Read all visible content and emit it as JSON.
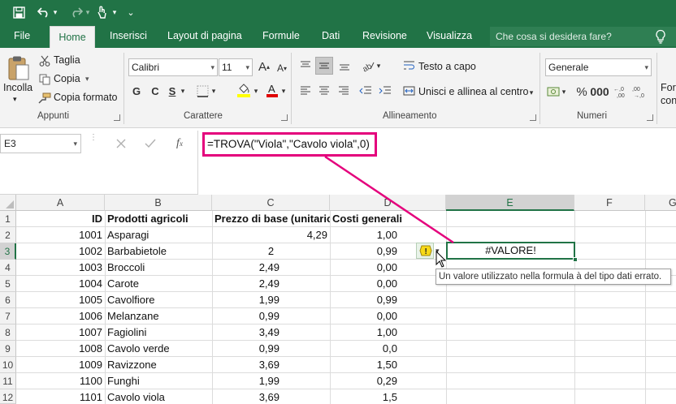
{
  "qat": {
    "more": "⌄"
  },
  "tabs": [
    "File",
    "Home",
    "Inserisci",
    "Layout di pagina",
    "Formule",
    "Dati",
    "Revisione",
    "Visualizza"
  ],
  "tellme": "Che cosa si desidera fare?",
  "ribbon": {
    "paste": "Incolla",
    "cut": "Taglia",
    "copy": "Copia",
    "format_painter": "Copia formato",
    "clipboard_group": "Appunti",
    "font_name": "Calibri",
    "font_size": "11",
    "bold": "G",
    "italic": "C",
    "underline": "S",
    "font_group": "Carattere",
    "wrap_text": "Testo a capo",
    "merge_center": "Unisci e allinea al centro",
    "alignment_group": "Allineamento",
    "number_format": "Generale",
    "number_group": "Numeri",
    "cond_format_partial_1": "Form",
    "cond_format_partial_2": "cond"
  },
  "namebox": "E3",
  "formula": "=TROVA(\"Viola\",\"Cavolo viola\",0)",
  "columns": [
    "A",
    "B",
    "C",
    "D",
    "E",
    "F",
    "G"
  ],
  "rows": [
    "1",
    "2",
    "3",
    "4",
    "5",
    "6",
    "7",
    "8",
    "9",
    "10",
    "11",
    "12"
  ],
  "headers": {
    "id": "ID",
    "product": "Prodotti agricoli",
    "base_price": "Prezzo di base (unitario)",
    "costs": "Costi generali"
  },
  "data": [
    {
      "id": "1001",
      "product": "Asparagi",
      "price": "4,29",
      "cost": "1,00"
    },
    {
      "id": "1002",
      "product": "Barbabietole",
      "price": "2",
      "cost": "0,99"
    },
    {
      "id": "1003",
      "product": "Broccoli",
      "price": "2,49",
      "cost": "0,00"
    },
    {
      "id": "1004",
      "product": "Carote",
      "price": "2,49",
      "cost": "0,00"
    },
    {
      "id": "1005",
      "product": "Cavolfiore",
      "price": "1,99",
      "cost": "0,99"
    },
    {
      "id": "1006",
      "product": "Melanzane",
      "price": "0,99",
      "cost": "0,00"
    },
    {
      "id": "1007",
      "product": "Fagiolini",
      "price": "3,49",
      "cost": "1,00"
    },
    {
      "id": "1008",
      "product": "Cavolo verde",
      "price": "0,99",
      "cost": "0,0"
    },
    {
      "id": "1009",
      "product": "Ravizzone",
      "price": "3,69",
      "cost": "1,50"
    },
    {
      "id": "1100",
      "product": "Funghi",
      "price": "1,99",
      "cost": "0,29"
    },
    {
      "id": "1101",
      "product": "Cavolo viola",
      "price": "3,69",
      "cost": "1,5"
    }
  ],
  "error_value": "#VALORE!",
  "tooltip": "Un valore utilizzato nella formula à del tipo dati errato.",
  "colors": {
    "excel_green": "#217346",
    "callout": "#e4007c",
    "selection": "#217346"
  }
}
